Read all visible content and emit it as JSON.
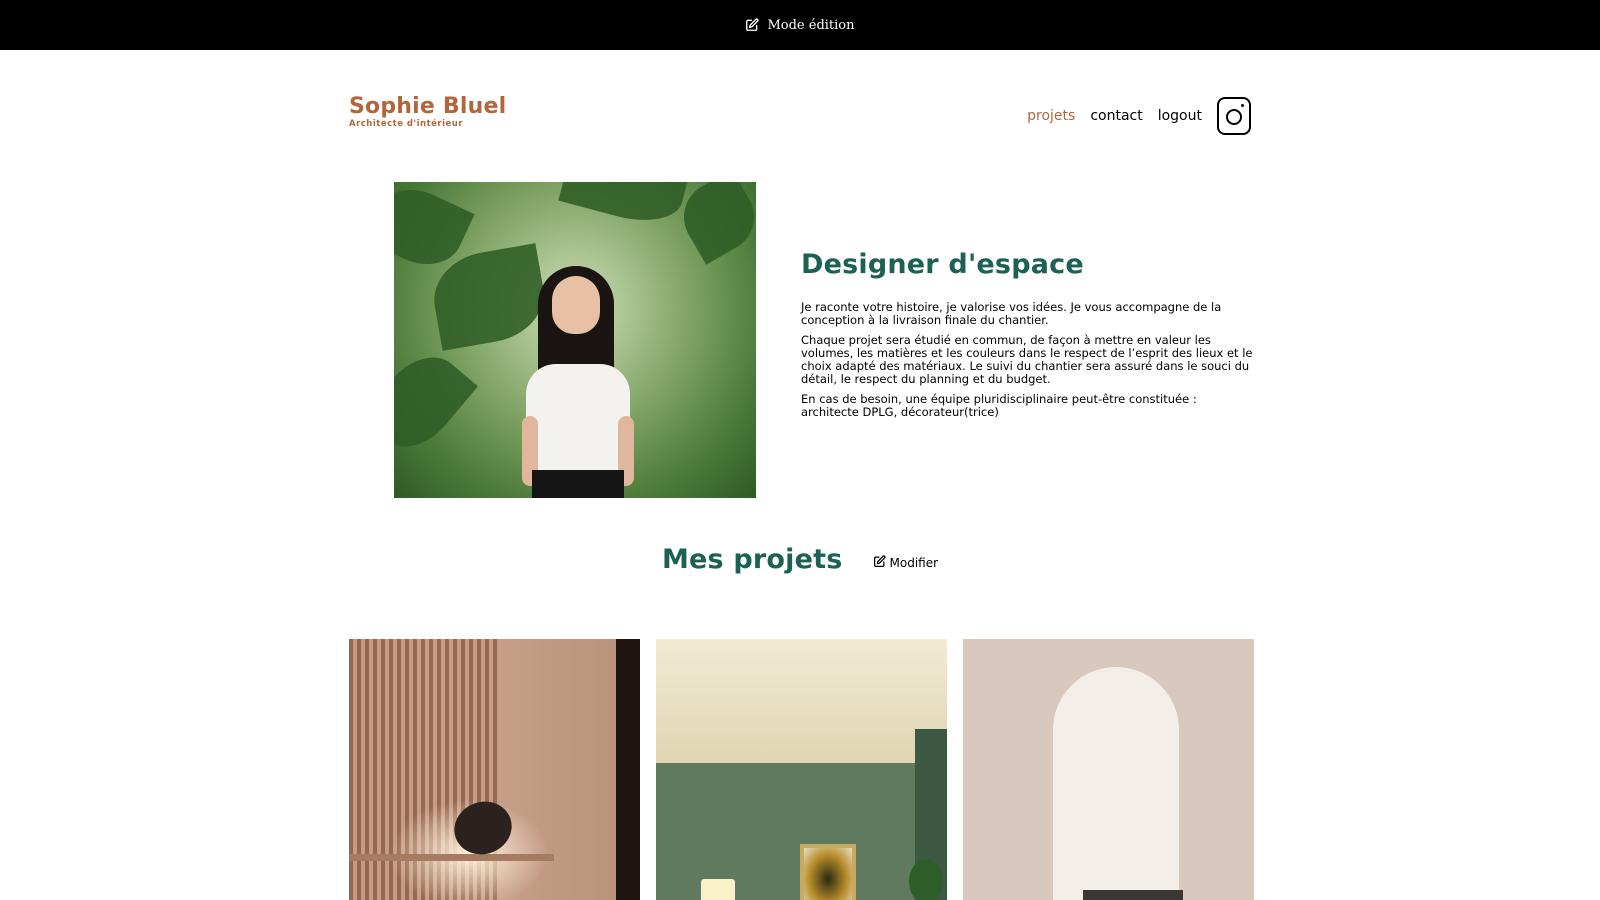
{
  "edit_bar": {
    "label": "Mode édition"
  },
  "header": {
    "logo_name": "Sophie Bluel",
    "logo_subtitle": "Architecte d'intérieur",
    "nav": {
      "projets": "projets",
      "contact": "contact",
      "logout": "logout"
    }
  },
  "introduction": {
    "title": "Designer d'espace",
    "paragraphs": [
      "Je raconte votre histoire, je valorise vos idées. Je vous accompagne de la conception à la livraison finale du chantier.",
      "Chaque projet sera étudié en commun, de façon à mettre en valeur les volumes, les matières et les couleurs dans le respect de l’esprit des lieux et le choix adapté des matériaux. Le suivi du chantier sera assuré dans le souci du détail, le respect du planning et du budget.",
      "En cas de besoin, une équipe pluridisciplinaire peut-être constituée : architecte DPLG, décorateur(trice)"
    ]
  },
  "portfolio": {
    "title": "Mes projets",
    "edit_label": "Modifier"
  },
  "colors": {
    "accent": "#b1663c",
    "heading": "#1d6154",
    "edit_bar_bg": "#000000"
  }
}
